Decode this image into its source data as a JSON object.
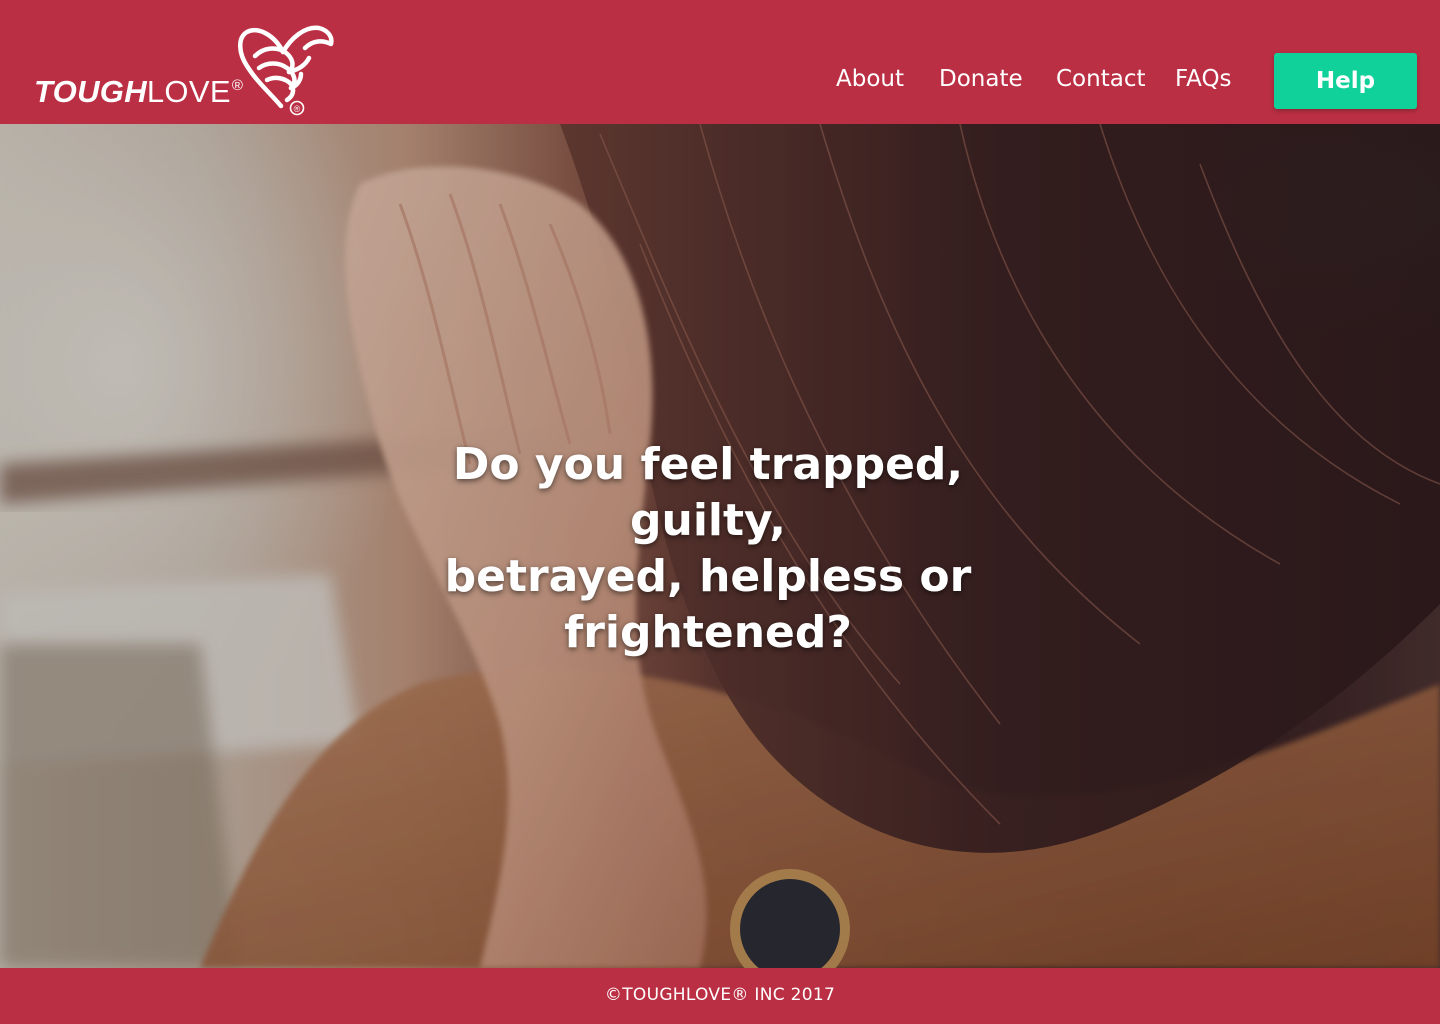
{
  "brand": {
    "logo_tough": "TOUGH",
    "logo_love": "LOVE",
    "logo_reg": "®",
    "logo_heart_reg": "®"
  },
  "nav": {
    "items": [
      {
        "label": "About"
      },
      {
        "label": "Donate"
      },
      {
        "label": "Contact"
      },
      {
        "label": "FAQs"
      }
    ],
    "help_label": "Help"
  },
  "hero": {
    "headline_line1": "Do you feel trapped, guilty,",
    "headline_line2": "betrayed, helpless or",
    "headline_line3": "frightened?"
  },
  "footer": {
    "copyright": "©TOUGHLOVE® INC 2017"
  },
  "colors": {
    "brand_red": "#bb2f44",
    "help_green": "#10d19a",
    "text_white": "#ffffff"
  }
}
